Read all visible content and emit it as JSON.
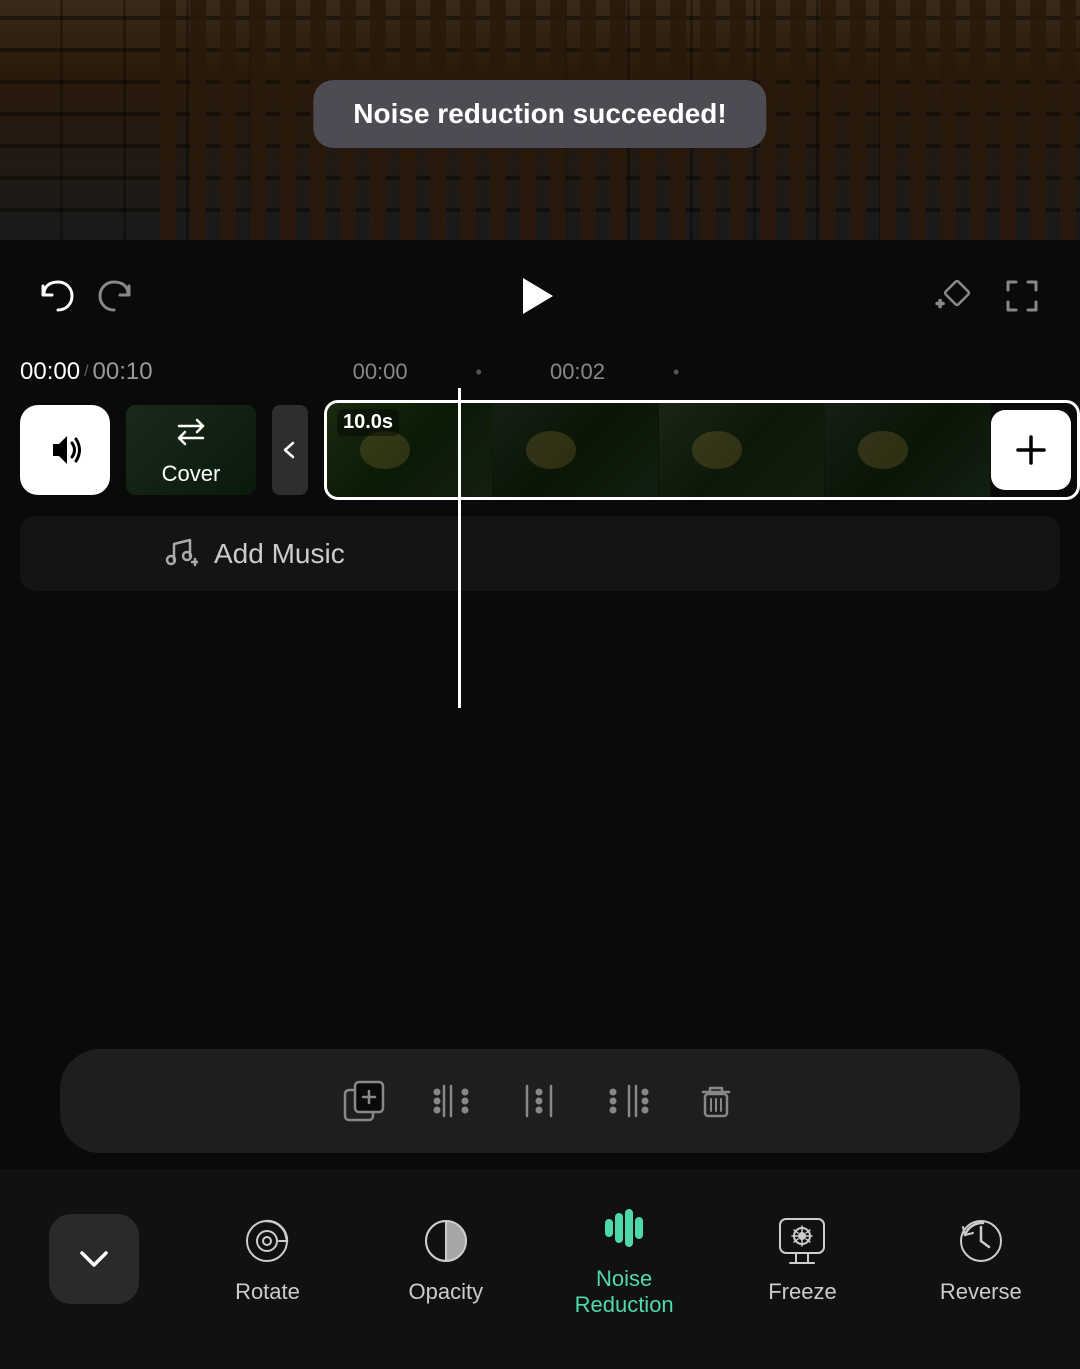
{
  "toast": {
    "message": "Noise reduction succeeded!"
  },
  "playback": {
    "undo_label": "undo",
    "redo_label": "redo",
    "play_label": "play",
    "add_keyframe_label": "add keyframe",
    "fullscreen_label": "fullscreen"
  },
  "timeline": {
    "current_time": "00:00",
    "total_time": "00:10",
    "mark_0": "00:00",
    "mark_2": "00:02",
    "clip_duration": "10.0s",
    "cover_label": "Cover"
  },
  "tracks": {
    "add_music_label": "Add Music"
  },
  "toolbar": {
    "copy_label": "copy",
    "split_start_label": "split start",
    "split_label": "split",
    "split_end_label": "split end",
    "delete_label": "delete"
  },
  "actions": {
    "rotate_label": "Rotate",
    "opacity_label": "Opacity",
    "noise_reduction_label": "Noise\nReduction",
    "freeze_label": "Freeze",
    "reverse_label": "Reverse",
    "collapse_label": "collapse"
  },
  "colors": {
    "accent": "#4dd9ac",
    "white": "#ffffff",
    "dark_bg": "#0a0a0a",
    "toolbar_bg": "#1e1e1e"
  }
}
